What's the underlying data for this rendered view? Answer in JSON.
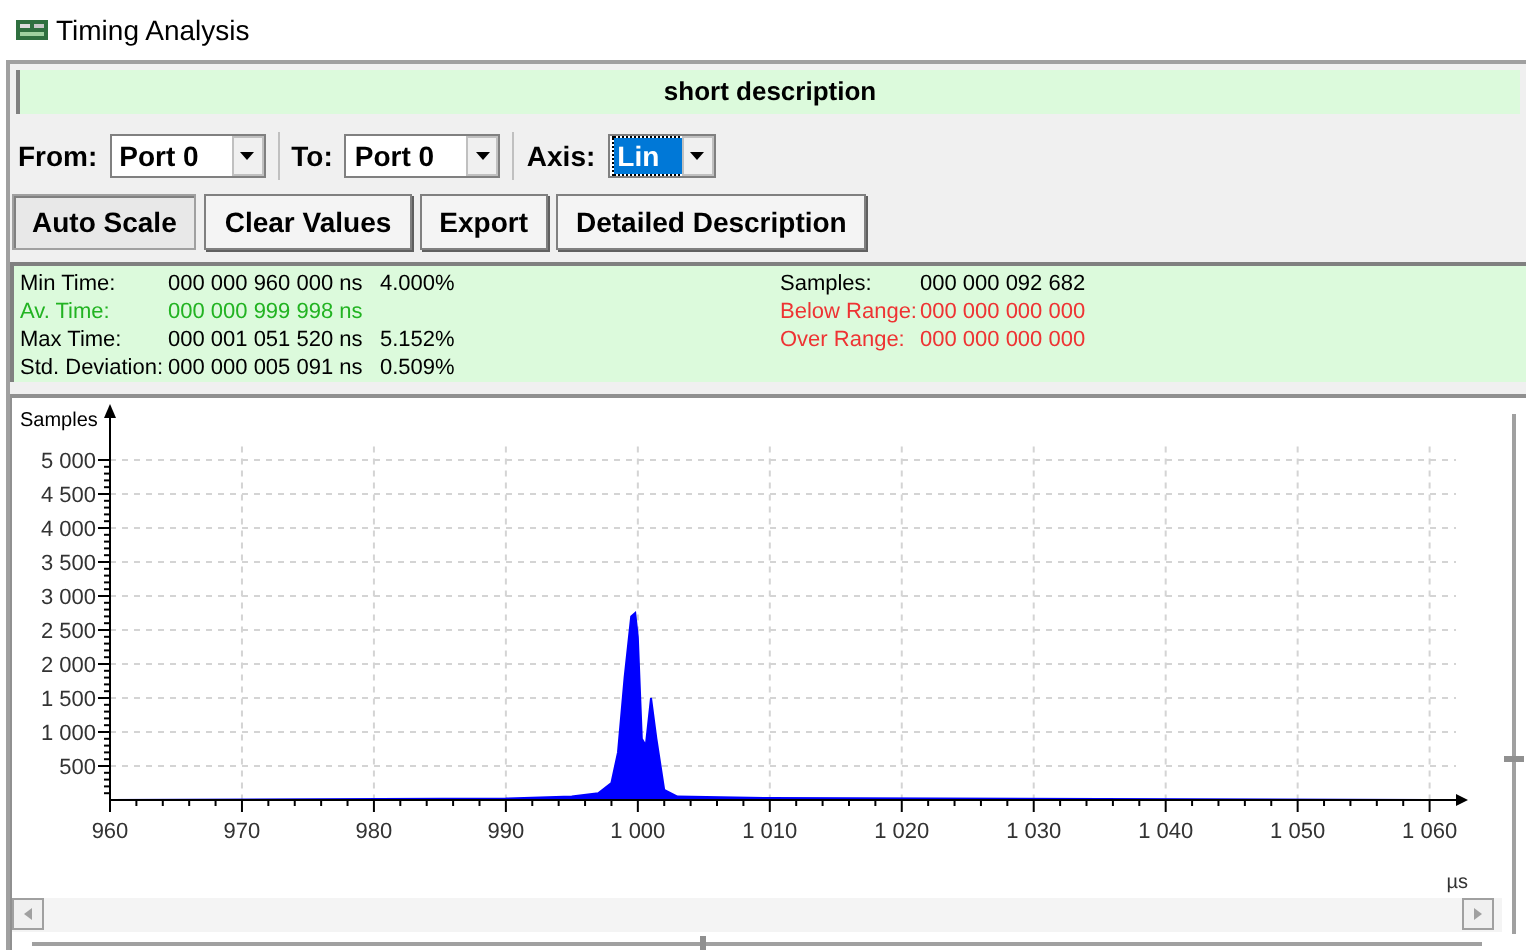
{
  "window": {
    "title": "Timing Analysis"
  },
  "description": "short description",
  "selectors": [
    {
      "label": "From:",
      "value": "Port 0",
      "focused": false
    },
    {
      "label": "To:",
      "value": "Port 0",
      "focused": false
    },
    {
      "label": "Axis:",
      "value": "Lin",
      "focused": true
    }
  ],
  "buttons": [
    {
      "label": "Auto Scale",
      "pressed": true
    },
    {
      "label": "Clear Values",
      "pressed": false
    },
    {
      "label": "Export",
      "pressed": false
    },
    {
      "label": "Detailed Description",
      "pressed": false
    }
  ],
  "stats_left": [
    {
      "label": "Min Time:",
      "value": "000 000 960 000 ns",
      "percent": "4.000%",
      "color": "#000000"
    },
    {
      "label": "Av. Time:",
      "value": "000 000 999 998 ns",
      "color": "#22b322"
    },
    {
      "label": "Max Time:",
      "value": "000 001 051 520 ns",
      "percent": "5.152%",
      "color": "#000000"
    },
    {
      "label": "Std. Deviation:",
      "value": "000 000 005 091 ns",
      "percent": "0.509%",
      "color": "#000000"
    }
  ],
  "stats_right": [
    {
      "label": "Samples:",
      "value": "000 000 092 682",
      "color": "#000000"
    },
    {
      "label": "Below Range:",
      "value": "000 000 000 000",
      "color": "#ee3333"
    },
    {
      "label": "Over Range:",
      "value": "000 000 000 000",
      "color": "#ee3333"
    }
  ],
  "chart": {
    "chart_data": {
      "type": "area",
      "ylabel": "Samples",
      "xlabel": "µs",
      "x": [
        960,
        990,
        995,
        997,
        998,
        998.5,
        999,
        999.5,
        999.8,
        1000,
        1000.3,
        1000.6,
        1001,
        1001.4,
        1002,
        1003,
        1010,
        1060
      ],
      "grid": true,
      "series": [
        {
          "color": "#0000ff",
          "values": [
            0,
            20,
            50,
            100,
            250,
            700,
            1800,
            2700,
            2750,
            2400,
            900,
            800,
            1500,
            900,
            150,
            50,
            30,
            0
          ]
        }
      ],
      "xlim": [
        960,
        1062
      ],
      "ylim": [
        0,
        5200
      ],
      "xticks": [
        {
          "value": 960,
          "label": "960"
        },
        {
          "value": 970,
          "label": "970"
        },
        {
          "value": 980,
          "label": "980"
        },
        {
          "value": 990,
          "label": "990"
        },
        {
          "value": 1000,
          "label": "1 000"
        },
        {
          "value": 1010,
          "label": "1 010"
        },
        {
          "value": 1020,
          "label": "1 020"
        },
        {
          "value": 1030,
          "label": "1 030"
        },
        {
          "value": 1040,
          "label": "1 040"
        },
        {
          "value": 1050,
          "label": "1 050"
        },
        {
          "value": 1060,
          "label": "1 060"
        }
      ],
      "yticks": [
        {
          "value": 500,
          "label": "500"
        },
        {
          "value": 1000,
          "label": "1 000"
        },
        {
          "value": 1500,
          "label": "1 500"
        },
        {
          "value": 2000,
          "label": "2 000"
        },
        {
          "value": 2500,
          "label": "2 500"
        },
        {
          "value": 3000,
          "label": "3 000"
        },
        {
          "value": 3500,
          "label": "3 500"
        },
        {
          "value": 4000,
          "label": "4 000"
        },
        {
          "value": 4500,
          "label": "4 500"
        },
        {
          "value": 5000,
          "label": "5 000"
        }
      ]
    }
  },
  "zoom_slider": {
    "level": 0.33
  },
  "position_slider": {
    "level": 0.46
  }
}
